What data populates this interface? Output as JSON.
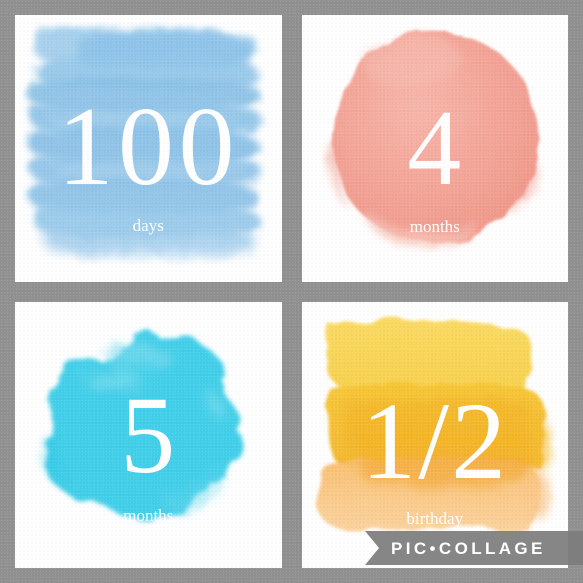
{
  "app": {
    "name": "PicCollage",
    "watermark_text": "PIC•COLLAGE",
    "background_color": "#919191",
    "card_color": "#ffffff",
    "watermark_ribbon_color": "#7d7d7d"
  },
  "collage": {
    "layout": "2x2-grid",
    "tile_count": 4,
    "tiles": [
      {
        "id": "tile-days",
        "position": "top-left",
        "numeral": "100",
        "label": "days",
        "art_style": "watercolor-horizontal-brush-strokes",
        "accent_color": "#8fc5e7",
        "accent_color_light": "#bcdcf1",
        "accent_color_deep": "#7ab6de",
        "text_color": "#ffffff"
      },
      {
        "id": "tile-months4",
        "position": "top-right",
        "numeral": "4",
        "label": "months",
        "art_style": "watercolor-round-blob",
        "accent_color": "#f2a193",
        "accent_color_light": "#f8c6bc",
        "accent_color_deep": "#ef9385",
        "text_color": "#ffffff"
      },
      {
        "id": "tile-months5",
        "position": "bottom-left",
        "numeral": "5",
        "label": "months",
        "art_style": "watercolor-cloud-splat",
        "accent_color": "#3ccde8",
        "accent_color_light": "#86e0f1",
        "accent_color_deep": "#28c6e5",
        "text_color": "#ffffff"
      },
      {
        "id": "tile-birthday",
        "position": "bottom-right",
        "numeral": "1/2",
        "label": "birthday",
        "art_style": "watercolor-stacked-bands",
        "accent_color": "#f6cb3f",
        "accent_color_light": "#f9d95e",
        "accent_color_deep": "#f3b427",
        "accent_color_bottom": "#f9c98c",
        "text_color": "#ffffff"
      }
    ]
  }
}
